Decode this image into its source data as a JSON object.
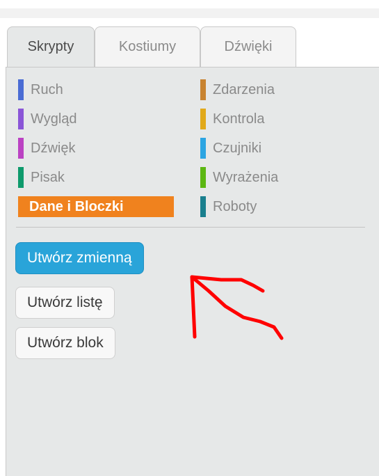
{
  "tabs": [
    {
      "label": "Skrypty",
      "active": true
    },
    {
      "label": "Kostiumy",
      "active": false
    },
    {
      "label": "Dźwięki",
      "active": false
    }
  ],
  "categories_left": [
    {
      "label": "Ruch",
      "color": "#4a6cd4"
    },
    {
      "label": "Wygląd",
      "color": "#8a55d7"
    },
    {
      "label": "Dźwięk",
      "color": "#bb42c3"
    },
    {
      "label": "Pisak",
      "color": "#0e9a6c"
    },
    {
      "label": "Dane i Bloczki",
      "color": "#ee7d16",
      "selected": true
    }
  ],
  "categories_right": [
    {
      "label": "Zdarzenia",
      "color": "#c88330"
    },
    {
      "label": "Kontrola",
      "color": "#e1a91a"
    },
    {
      "label": "Czujniki",
      "color": "#2ca5e2"
    },
    {
      "label": "Wyrażenia",
      "color": "#5cb712"
    },
    {
      "label": "Roboty",
      "color": "#1a7f8e"
    }
  ],
  "buttons": {
    "make_variable": "Utwórz zmienną",
    "make_list": "Utwórz listę",
    "make_block": "Utwórz blok"
  },
  "accent_colors": {
    "selected_category": "#f0821e",
    "primary_button": "#29a4d9",
    "annotation_arrow": "#ff0000"
  }
}
